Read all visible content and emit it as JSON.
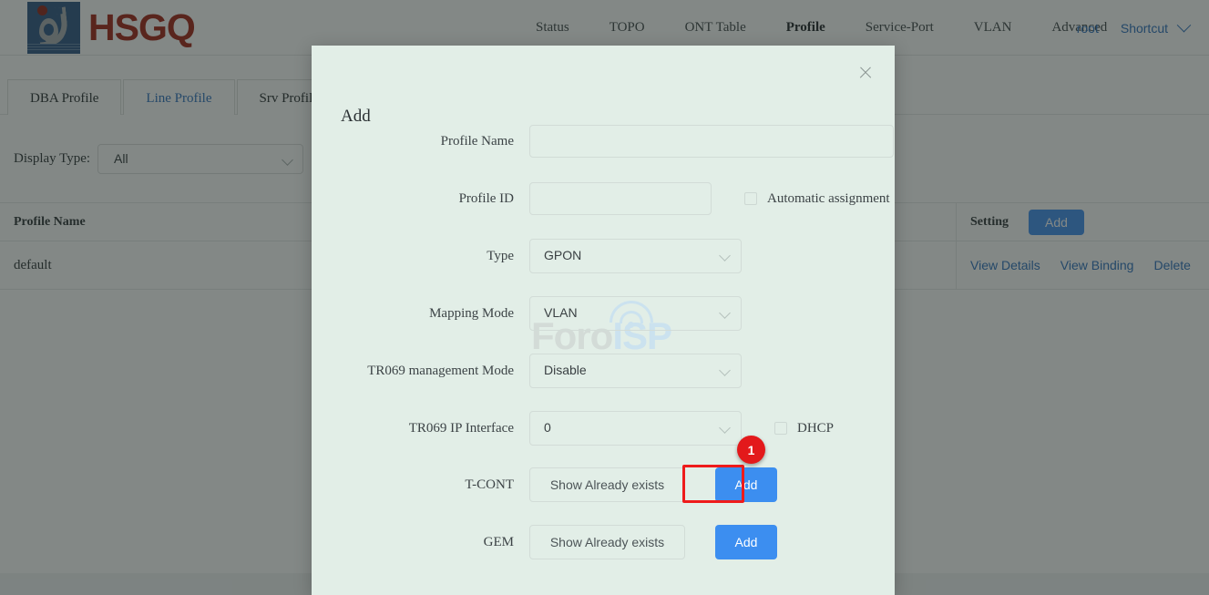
{
  "brand": {
    "name": "HSGQ"
  },
  "nav": {
    "items": [
      {
        "label": "Status",
        "active": false
      },
      {
        "label": "TOPO",
        "active": false
      },
      {
        "label": "ONT Table",
        "active": false
      },
      {
        "label": "Profile",
        "active": true
      },
      {
        "label": "Service-Port",
        "active": false
      },
      {
        "label": "VLAN",
        "active": false
      },
      {
        "label": "Advanced",
        "active": false
      }
    ],
    "user": "root",
    "shortcut": "Shortcut"
  },
  "tabs": [
    {
      "label": "DBA Profile",
      "active": false
    },
    {
      "label": "Line Profile",
      "active": true
    },
    {
      "label": "Srv Profile",
      "active": false
    }
  ],
  "filter": {
    "label": "Display Type:",
    "value": "All"
  },
  "table": {
    "headers": {
      "name": "Profile Name",
      "setting": "Setting"
    },
    "add_button": "Add",
    "rows": [
      {
        "name": "default",
        "actions": [
          "View Details",
          "View Binding",
          "Delete"
        ]
      }
    ]
  },
  "watermark": {
    "part1": "Foro",
    "part2": "ISP"
  },
  "modal": {
    "title": "Add",
    "fields": {
      "profile_name": {
        "label": "Profile Name",
        "value": "",
        "placeholder": ""
      },
      "profile_id": {
        "label": "Profile ID",
        "value": "",
        "placeholder": ""
      },
      "automatic_assignment": {
        "label": "Automatic assignment",
        "checked": false
      },
      "type": {
        "label": "Type",
        "value": "GPON"
      },
      "mapping_mode": {
        "label": "Mapping Mode",
        "value": "VLAN"
      },
      "tr069_management_mode": {
        "label": "TR069 management Mode",
        "value": "Disable"
      },
      "tr069_ip_interface": {
        "label": "TR069 IP Interface",
        "value": "0"
      },
      "dhcp": {
        "label": "DHCP",
        "checked": false
      },
      "tcont": {
        "label": "T-CONT",
        "show_button": "Show Already exists",
        "add_button": "Add"
      },
      "gem": {
        "label": "GEM",
        "show_button": "Show Already exists",
        "add_button": "Add"
      }
    }
  },
  "annotation": {
    "step": "1"
  },
  "colors": {
    "brand_red": "#a01f12",
    "logo_blue": "#2b5382",
    "link_blue": "#2a6fbd",
    "button_blue": "#3c8ef0",
    "modal_bg": "#e2eee7",
    "highlight_red": "#ee1b1b",
    "badge_red": "#e3191b"
  }
}
